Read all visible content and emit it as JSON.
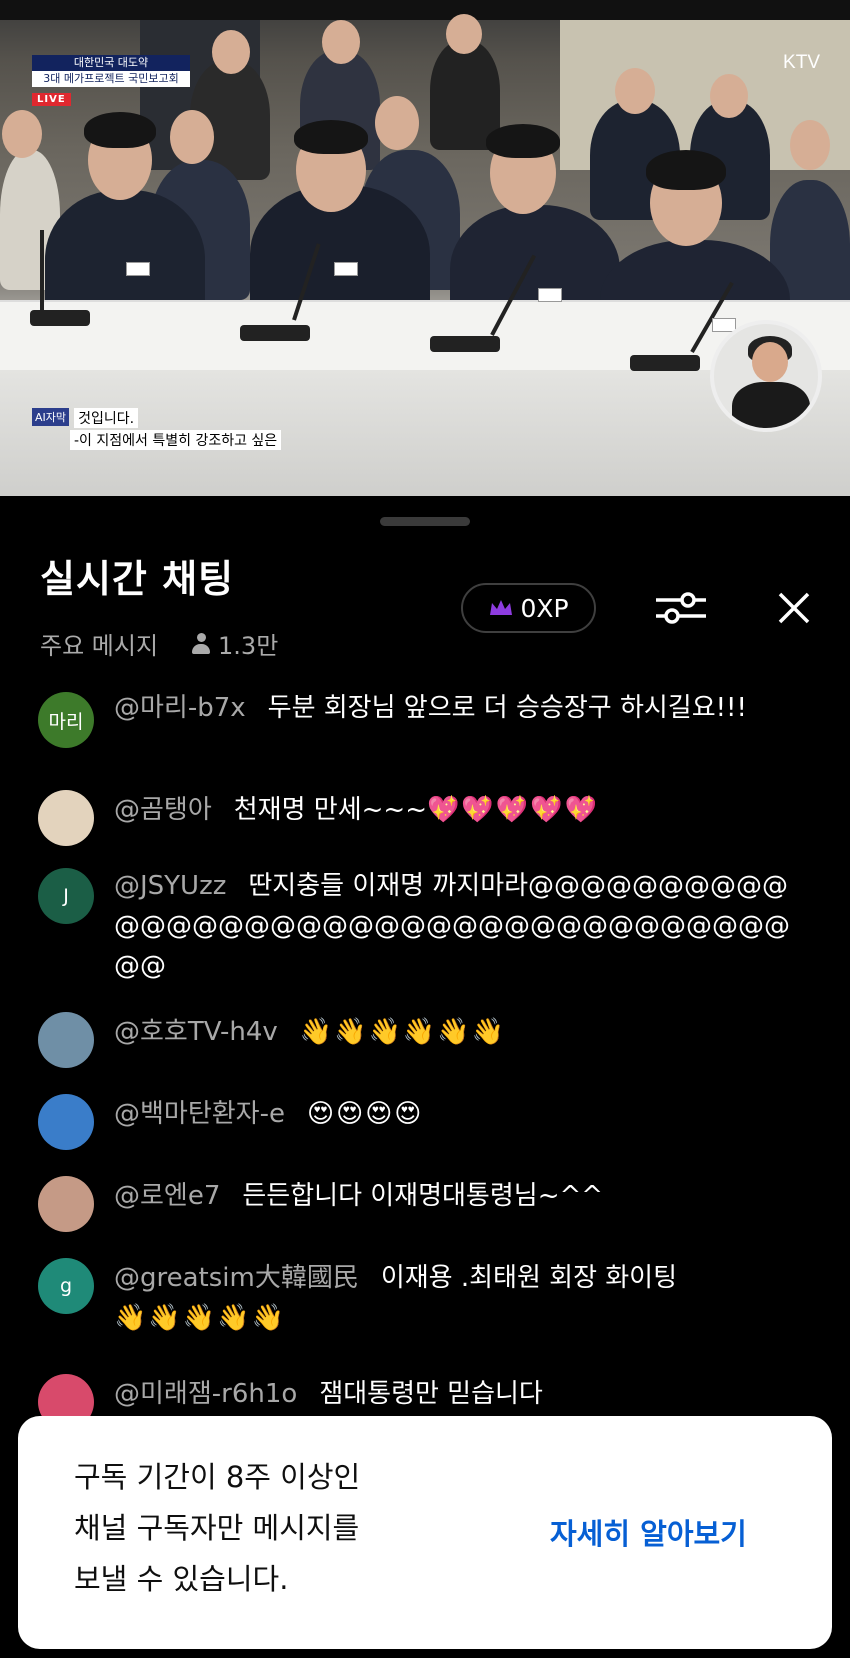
{
  "video": {
    "brand_line1": "대한민국 대도약",
    "brand_line2": "3대 메가프로젝트 국민보고회",
    "live_label": "LIVE",
    "channel_logo": "KTV",
    "caption_tag": "AI자막",
    "caption_line1": "것입니다.",
    "caption_line2": "-이 지점에서 특별히 강조하고 싶은"
  },
  "chat": {
    "title": "실시간 채팅",
    "mode_label": "주요 메시지",
    "viewer_count": "1.3만",
    "xp_label": "0XP",
    "icons": {
      "crown": "crown-icon",
      "settings": "sliders-icon",
      "close": "close-icon",
      "viewers": "person-icon"
    },
    "messages": [
      {
        "avatar_text": "마리",
        "avatar_color": "#3d7a2a",
        "author": "@마리-b7x",
        "text": "두분 회장님 앞으로 더 승승장구 하시길요!!!",
        "emojis": ""
      },
      {
        "avatar_text": "",
        "avatar_color": "#e3d3bd",
        "author": "@곰탱아",
        "text": "천재명 만세~~~",
        "emojis": "💖💖💖💖💖"
      },
      {
        "avatar_text": "J",
        "avatar_color": "#1b5e46",
        "author": "@JSYUzz",
        "text": "딴지충들 이재명 까지마라@@@@@@@@@@@@@@@@@@@@@@@@@@@@@@@@@@@@@@",
        "emojis": ""
      },
      {
        "avatar_text": "",
        "avatar_color": "#6f8fa6",
        "author": "@호호TV-h4v",
        "text": "",
        "emojis": "👋👋👋👋👋👋"
      },
      {
        "avatar_text": "",
        "avatar_color": "#3a7dc9",
        "author": "@백마탄환자-e",
        "text": "",
        "emojis": "😍😍😍😍"
      },
      {
        "avatar_text": "",
        "avatar_color": "#c59a86",
        "author": "@로엔e7",
        "text": "든든합니다 이재명대통령님~^^",
        "emojis": ""
      },
      {
        "avatar_text": "g",
        "avatar_color": "#1f8a78",
        "author": "@greatsim大韓國民",
        "text": "이재용 .최태원 회장 화이팅",
        "emojis": "👋👋👋👋👋"
      },
      {
        "avatar_text": "",
        "avatar_color": "#d84a6b",
        "author": "@미래잼-r6h1o",
        "text": "잼대통령만 믿습니다",
        "emojis": ""
      }
    ]
  },
  "notice": {
    "line1": "구독 기간이 8주 이상인",
    "line2": "채널 구독자만 메시지를",
    "line3": "보낼 수 있습니다.",
    "link_label": "자세히 알아보기"
  },
  "colors": {
    "background": "#000000",
    "link": "#065fd4",
    "author": "#a8a8a8",
    "live": "#e0282f"
  }
}
